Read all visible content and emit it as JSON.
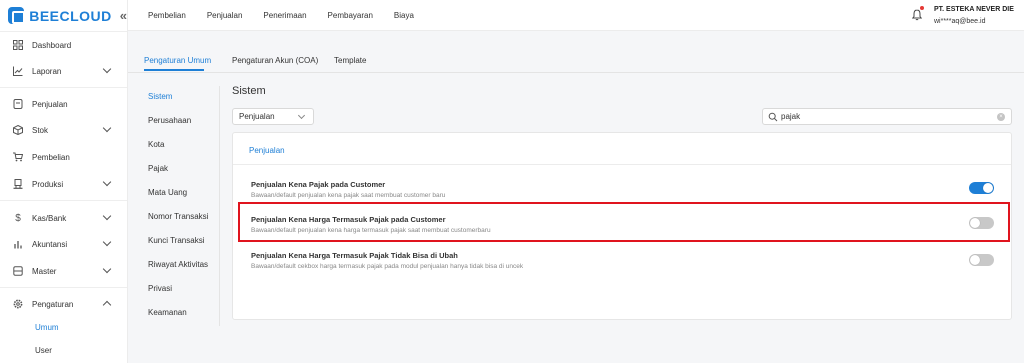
{
  "brand": {
    "name": "BEECLOUD"
  },
  "sidebar": {
    "items": [
      {
        "label": "Dashboard",
        "icon": "grid-icon"
      },
      {
        "label": "Laporan",
        "icon": "chart-line-icon",
        "expandable": true
      },
      {
        "label": "Penjualan",
        "icon": "receipt-icon"
      },
      {
        "label": "Stok",
        "icon": "box-icon",
        "expandable": true
      },
      {
        "label": "Pembelian",
        "icon": "cart-icon"
      },
      {
        "label": "Produksi",
        "icon": "factory-icon",
        "expandable": true
      },
      {
        "label": "Kas/Bank",
        "icon": "dollar-icon",
        "expandable": true
      },
      {
        "label": "Akuntansi",
        "icon": "bar-chart-icon",
        "expandable": true
      },
      {
        "label": "Master",
        "icon": "database-icon",
        "expandable": true
      },
      {
        "label": "Pengaturan",
        "icon": "gear-icon",
        "expanded": true
      }
    ],
    "sub_items": [
      {
        "label": "Umum",
        "active": true
      },
      {
        "label": "User"
      }
    ]
  },
  "topbar": {
    "nav": [
      "Pembelian",
      "Penjualan",
      "Penerimaan",
      "Pembayaran",
      "Biaya"
    ],
    "company": "PT. ESTEKA NEVER DIE",
    "email": "wi****aq@bee.id"
  },
  "tabs": [
    "Pengaturan Umum",
    "Pengaturan Akun (COA)",
    "Template"
  ],
  "submenu": [
    "Sistem",
    "Perusahaan",
    "Kota",
    "Pajak",
    "Mata Uang",
    "Nomor Transaksi",
    "Kunci Transaksi",
    "Riwayat Aktivitas",
    "Privasi",
    "Keamanan"
  ],
  "section_title": "Sistem",
  "filter": {
    "selected": "Penjualan"
  },
  "search": {
    "value": "pajak"
  },
  "panel": {
    "header": "Penjualan",
    "rows": [
      {
        "title": "Penjualan Kena Pajak pada Customer",
        "desc": "Bawaan/default penjualan kena pajak saat membuat customer baru",
        "enabled": true
      },
      {
        "title": "Penjualan Kena Harga Termasuk Pajak pada Customer",
        "desc": "Bawaan/default penjualan kena harga termasuk pajak saat membuat customerbaru",
        "enabled": false
      },
      {
        "title": "Penjualan Kena Harga Termasuk Pajak Tidak Bisa di Ubah",
        "desc": "Bawaan/default cekbox harga termasuk pajak pada modul penjualan hanya tidak bisa di uncek",
        "enabled": false
      }
    ]
  },
  "colors": {
    "accent": "#1e7fd6",
    "highlight": "#e0141e",
    "notification": "#e53935"
  }
}
